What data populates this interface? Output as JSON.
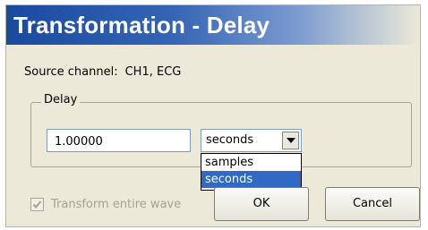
{
  "dialog": {
    "title": "Transformation - Delay",
    "source": {
      "label": "Source channel:",
      "value": "CH1, ECG"
    },
    "delay_group": {
      "label": "Delay",
      "value": "1.00000",
      "unit_selected": "seconds",
      "unit_options": [
        "samples",
        "seconds"
      ],
      "highlighted_option": "seconds"
    },
    "transform_entire_wave": {
      "label": "Transform entire wave",
      "checked": true,
      "enabled": false
    },
    "buttons": {
      "ok": "OK",
      "cancel": "Cancel"
    }
  },
  "icons": {
    "dropdown": "chevron-down-icon",
    "check": "checkmark-icon"
  },
  "colors": {
    "title_bar": "#1a4a9e",
    "dialog_bg": "#ece9d8",
    "selection": "#316ac5",
    "disabled_text": "#a6a291"
  }
}
